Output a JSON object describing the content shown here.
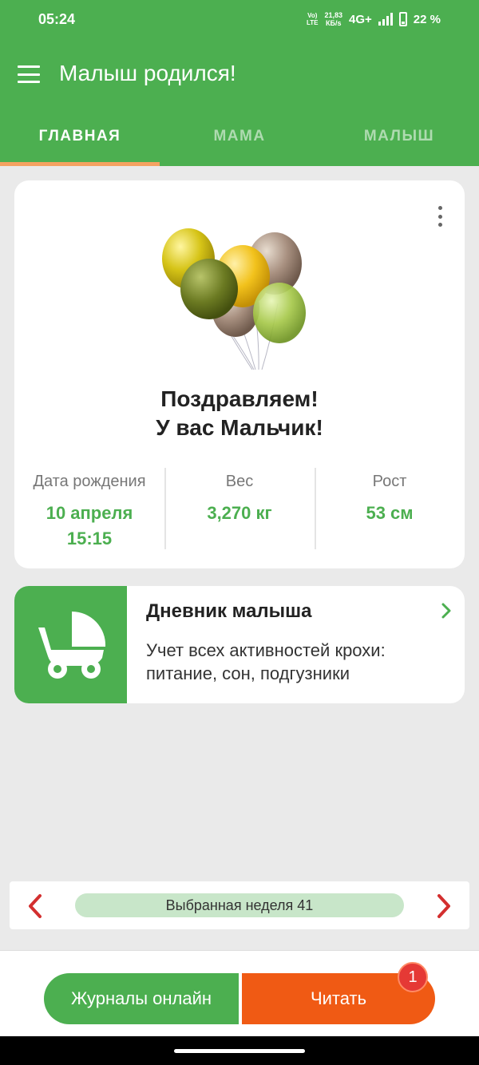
{
  "status_bar": {
    "time": "05:24",
    "volte": "VoLTE",
    "net_speed_value": "21,83",
    "net_speed_unit": "КБ/s",
    "network": "4G+",
    "battery": "22 %"
  },
  "app_bar": {
    "title": "Малыш родился!",
    "menu_icon": "hamburger-menu-icon"
  },
  "tabs": [
    {
      "label": "ГЛАВНАЯ",
      "active": true
    },
    {
      "label": "МАМА",
      "active": false
    },
    {
      "label": "МАЛЫШ",
      "active": false
    }
  ],
  "birth_card": {
    "image": "balloons-illustration",
    "congrats_line1": "Поздравляем!",
    "congrats_line2": "У вас Мальчик!",
    "stats": [
      {
        "label": "Дата рождения",
        "value_line1": "10 апреля",
        "value_line2": "15:15"
      },
      {
        "label": "Вес",
        "value_line1": "3,270 кг",
        "value_line2": ""
      },
      {
        "label": "Рост",
        "value_line1": "53 см",
        "value_line2": ""
      }
    ]
  },
  "diary_card": {
    "icon": "baby-stroller-icon",
    "title": "Дневник малыша",
    "description": "Учет всех активностей крохи: питание, сон, подгузники"
  },
  "week_selector": {
    "label": "Выбранная неделя 41"
  },
  "bottom_buttons": {
    "journals_label": "Журналы онлайн",
    "read_label": "Читать",
    "read_badge": "1"
  },
  "colors": {
    "primary_green": "#4caf50",
    "tab_indicator": "#f4a261",
    "read_button": "#f05a14",
    "badge": "#e53935",
    "arrow_red": "#d32f2f",
    "week_pill": "#c8e6c9"
  }
}
